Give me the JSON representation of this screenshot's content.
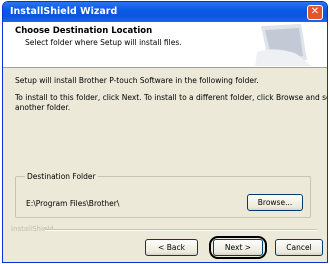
{
  "window": {
    "title": "InstallShield Wizard"
  },
  "header": {
    "title": "Choose Destination Location",
    "subtitle": "Select folder where Setup will install files."
  },
  "body": {
    "line1": "Setup will install Brother P-touch Software in the following folder.",
    "line2": "To install to this folder, click Next. To install to a different folder, click Browse and select",
    "line3": "another folder."
  },
  "destination": {
    "group_label": "Destination Folder",
    "path": "E:\\Program Files\\Brother\\",
    "browse_label": "Browse..."
  },
  "footer": {
    "brand": "InstallShield",
    "back_label": "< Back",
    "next_label": "Next >",
    "cancel_label": "Cancel"
  }
}
